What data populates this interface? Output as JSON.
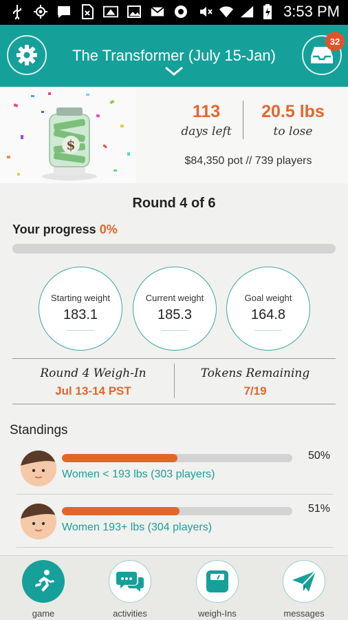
{
  "status_bar": {
    "time": "3:53 PM"
  },
  "header": {
    "title": "The Transformer (July 15-Jan)",
    "inbox_badge": "32"
  },
  "hero": {
    "days_left_value": "113",
    "days_left_label": "days left",
    "to_lose_value": "20.5 lbs",
    "to_lose_label": "to lose",
    "pot_text": "$84,350 pot // 739 players"
  },
  "round": {
    "title": "Round 4 of 6"
  },
  "progress": {
    "label": "Your progress",
    "percent_text": "0%",
    "fraction": 0
  },
  "weights": {
    "starting": {
      "label": "Starting weight",
      "value": "183.1"
    },
    "current": {
      "label": "Current weight",
      "value": "185.3"
    },
    "goal": {
      "label": "Goal weight",
      "value": "164.8"
    }
  },
  "weigh_in": {
    "label": "Round 4 Weigh-In",
    "value": "Jul 13-14 PST"
  },
  "tokens": {
    "label": "Tokens Remaining",
    "value": "7/19"
  },
  "standings": {
    "title": "Standings",
    "rows": [
      {
        "name": "Women < 193 lbs (303 players)",
        "percent_text": "50%",
        "fraction": 0.5
      },
      {
        "name": "Women 193+ lbs (304 players)",
        "percent_text": "51%",
        "fraction": 0.51
      }
    ]
  },
  "bottom_nav": {
    "items": [
      {
        "label": "game",
        "icon": "runner-icon",
        "active": true
      },
      {
        "label": "activities",
        "icon": "chat-bubbles-icon",
        "active": false
      },
      {
        "label": "weigh-Ins",
        "icon": "scale-icon",
        "active": false
      },
      {
        "label": "messages",
        "icon": "paper-plane-icon",
        "active": false
      }
    ]
  },
  "colors": {
    "teal": "#16a09a",
    "orange": "#e2662c",
    "background": "#f1f1ef"
  }
}
